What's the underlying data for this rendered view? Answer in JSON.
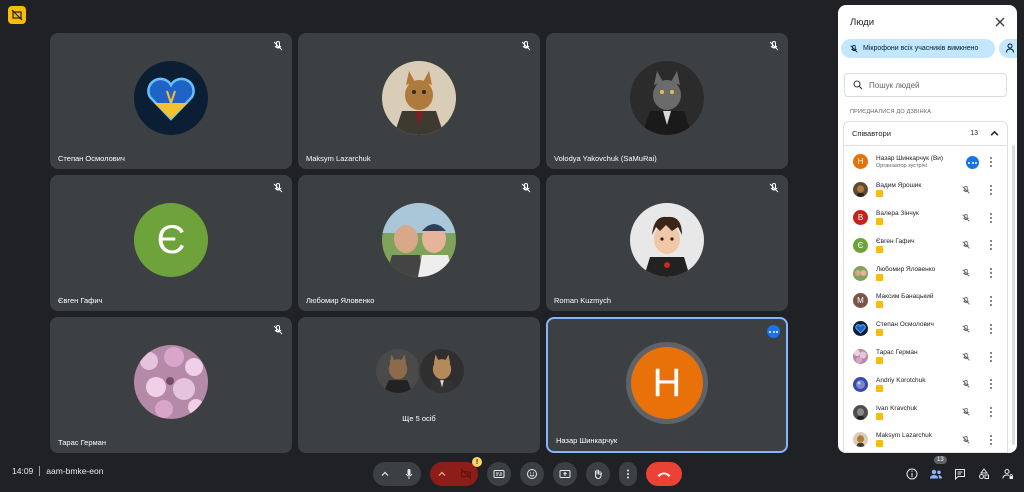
{
  "meeting": {
    "time": "14:09",
    "code": "aam-bmke-eon"
  },
  "tiles": [
    {
      "name": "Степан Осмолович",
      "avatar": "heart-avatar-icon"
    },
    {
      "name": "Maksym Lazarchuk",
      "avatar": "cat-suit-avatar-icon"
    },
    {
      "name": "Volodya Yakovchuk (SaMuRai)",
      "avatar": "cat-gentleman-avatar-icon"
    },
    {
      "name": "Євген Гафич",
      "avatar_letter": "Є",
      "avatar_color": "#6ea23a"
    },
    {
      "name": "Любомир Яловенко",
      "avatar": "photo-avatar-icon"
    },
    {
      "name": "Roman Kuzmych",
      "avatar": "cartoon-avatar-icon"
    },
    {
      "name": "Тарас Герман",
      "avatar": "flowers-avatar-icon"
    },
    {
      "more_label": "Ще 5 осіб"
    },
    {
      "name": "Назар Шинкарчук",
      "avatar_letter": "Н",
      "avatar_color": "#e8710a"
    }
  ],
  "controls": {
    "camera_warning": "!"
  },
  "right": {
    "people_count": "13"
  },
  "panel": {
    "title": "Люди",
    "mute_all_label": "Мікрофони всіх учасників вимкнено",
    "search_placeholder": "Пошук людей",
    "section_label": "ПРИЄДНАЛИСЯ ДО ДЗВІНКА",
    "group_title": "Співавтори",
    "group_count": "13",
    "participants": [
      {
        "name": "Назар Шинкарчук (Ви)",
        "sub": "Організатор зустрічі",
        "letter": "Н",
        "color": "#e8710a",
        "host": true
      },
      {
        "name": "Вадим Ярошик",
        "color": "#5f4b32"
      },
      {
        "name": "Валера Зінчук",
        "letter": "В",
        "color": "#c5221f"
      },
      {
        "name": "Євген Гафич",
        "letter": "Є",
        "color": "#6ea23a"
      },
      {
        "name": "Любомир Яловенко",
        "color": "#7a8a6a"
      },
      {
        "name": "Максим Банацький",
        "letter": "М",
        "color": "#795548"
      },
      {
        "name": "Степан Осмолович",
        "color": "#1d3557"
      },
      {
        "name": "Тарас Герман",
        "color": "#c9a0c0"
      },
      {
        "name": "Andriy Korotchuk",
        "color": "#3949ab"
      },
      {
        "name": "Ivan Kravchuk",
        "color": "#4e4e4e"
      },
      {
        "name": "Maksym Lazarchuk",
        "color": "#6d5a42"
      }
    ]
  }
}
